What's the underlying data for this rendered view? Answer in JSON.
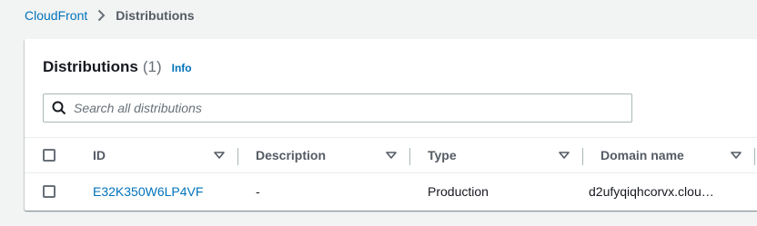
{
  "breadcrumb": {
    "root": "CloudFront",
    "current": "Distributions"
  },
  "panel": {
    "title": "Distributions",
    "count": "(1)",
    "info_label": "Info"
  },
  "search": {
    "placeholder": "Search all distributions",
    "value": ""
  },
  "table": {
    "columns": [
      {
        "label": "ID"
      },
      {
        "label": "Description"
      },
      {
        "label": "Type"
      },
      {
        "label": "Domain name"
      }
    ],
    "rows": [
      {
        "id": "E32K350W6LP4VF",
        "description": "-",
        "type": "Production",
        "domain_name": "d2ufyqiqhcorvx.clou…"
      }
    ]
  },
  "colors": {
    "link": "#0073bb",
    "page_background": "#f2f3f3",
    "header_text": "#545b64"
  }
}
